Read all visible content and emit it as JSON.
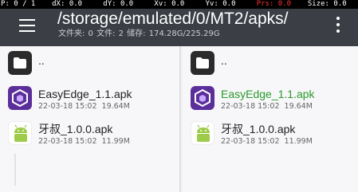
{
  "debug_bar": {
    "cells": [
      {
        "text": "P: 0 / 1",
        "highlight": false
      },
      {
        "text": "dX: 0.0",
        "highlight": false
      },
      {
        "text": "dY: 0.0",
        "highlight": false
      },
      {
        "text": "Xv: 0.0",
        "highlight": false
      },
      {
        "text": "Yv: 0.0",
        "highlight": false
      },
      {
        "text": "Prs: 0.0",
        "highlight": true
      },
      {
        "text": "Size: 0.0",
        "highlight": false
      }
    ]
  },
  "app_bar": {
    "title": "/storage/emulated/0/MT2/apks/",
    "subtitle": "文件夹: 0  文件: 2  储存: 174.28G/225.29G",
    "background": "#3b3f45"
  },
  "left_pane": {
    "parent_label": "..",
    "files": [
      {
        "name": "EasyEdge_1.1.apk",
        "date": "22-03-18 15:02",
        "size": "19.64M",
        "icon": "easyedge-app-icon"
      },
      {
        "name": "牙叔_1.0.0.apk",
        "date": "22-03-18 15:02",
        "size": "11.99M",
        "icon": "android-app-icon"
      }
    ]
  },
  "right_pane": {
    "parent_label": "..",
    "files": [
      {
        "name": "EasyEdge_1.1.apk",
        "date": "22-03-18 15:02",
        "size": "19.64M",
        "icon": "easyedge-app-icon",
        "highlight_color": "#2a9a2a"
      },
      {
        "name": "牙叔_1.0.0.apk",
        "date": "22-03-18 15:02",
        "size": "11.99M",
        "icon": "android-app-icon"
      }
    ]
  }
}
